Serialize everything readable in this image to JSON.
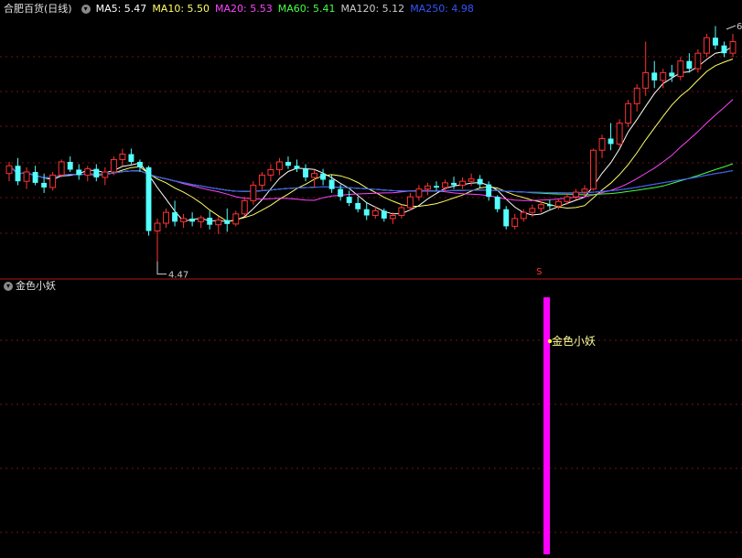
{
  "header": {
    "stock_name": "合肥百货(日线)",
    "ma": [
      {
        "label": "MA5:",
        "value": "5.47",
        "color": "#ffffff"
      },
      {
        "label": "MA10:",
        "value": "5.50",
        "color": "#ffff66"
      },
      {
        "label": "MA20:",
        "value": "5.53",
        "color": "#ff44ff"
      },
      {
        "label": "MA60:",
        "value": "5.41",
        "color": "#44ff44"
      },
      {
        "label": "MA120:",
        "value": "5.12",
        "color": "#cccccc"
      },
      {
        "label": "MA250:",
        "value": "4.98",
        "color": "#3355ff"
      }
    ]
  },
  "indicator": {
    "title": "金色小妖",
    "signal_label": "金色小妖",
    "signal_mark": "S"
  },
  "chart_data": {
    "type": "candlestick",
    "annotations": {
      "low_label": "4.47",
      "high_label": "6"
    },
    "colors": {
      "up": "#ff3333",
      "down": "#54ffff",
      "grid": "#7a1010",
      "signal": "#ff00ff"
    },
    "candles": [
      [
        5.6,
        5.75,
        5.5,
        5.7
      ],
      [
        5.7,
        5.8,
        5.45,
        5.5
      ],
      [
        5.5,
        5.68,
        5.4,
        5.62
      ],
      [
        5.62,
        5.7,
        5.45,
        5.48
      ],
      [
        5.48,
        5.6,
        5.35,
        5.42
      ],
      [
        5.42,
        5.62,
        5.38,
        5.58
      ],
      [
        5.58,
        5.78,
        5.55,
        5.75
      ],
      [
        5.75,
        5.82,
        5.62,
        5.65
      ],
      [
        5.65,
        5.72,
        5.52,
        5.58
      ],
      [
        5.58,
        5.7,
        5.5,
        5.66
      ],
      [
        5.66,
        5.72,
        5.5,
        5.55
      ],
      [
        5.55,
        5.68,
        5.45,
        5.62
      ],
      [
        5.62,
        5.82,
        5.58,
        5.78
      ],
      [
        5.78,
        5.92,
        5.7,
        5.85
      ],
      [
        5.85,
        5.92,
        5.72,
        5.75
      ],
      [
        5.75,
        5.78,
        5.62,
        5.68
      ],
      [
        5.68,
        5.7,
        4.8,
        4.86
      ],
      [
        4.86,
        5.02,
        4.47,
        4.96
      ],
      [
        4.96,
        5.15,
        4.9,
        5.1
      ],
      [
        5.1,
        5.25,
        4.92,
        4.98
      ],
      [
        4.98,
        5.08,
        4.9,
        5.02
      ],
      [
        5.02,
        5.1,
        4.92,
        4.98
      ],
      [
        4.98,
        5.06,
        4.9,
        5.03
      ],
      [
        5.03,
        5.12,
        4.88,
        4.94
      ],
      [
        4.94,
        5.05,
        4.82,
        5.0
      ],
      [
        5.0,
        5.15,
        4.85,
        4.95
      ],
      [
        4.95,
        5.12,
        4.92,
        5.08
      ],
      [
        5.08,
        5.3,
        5.05,
        5.25
      ],
      [
        5.25,
        5.5,
        5.2,
        5.45
      ],
      [
        5.45,
        5.62,
        5.38,
        5.58
      ],
      [
        5.58,
        5.72,
        5.5,
        5.65
      ],
      [
        5.65,
        5.8,
        5.58,
        5.75
      ],
      [
        5.75,
        5.82,
        5.66,
        5.7
      ],
      [
        5.7,
        5.78,
        5.62,
        5.66
      ],
      [
        5.66,
        5.72,
        5.5,
        5.55
      ],
      [
        5.55,
        5.65,
        5.42,
        5.6
      ],
      [
        5.6,
        5.66,
        5.45,
        5.52
      ],
      [
        5.52,
        5.58,
        5.35,
        5.4
      ],
      [
        5.4,
        5.46,
        5.25,
        5.3
      ],
      [
        5.3,
        5.38,
        5.18,
        5.22
      ],
      [
        5.22,
        5.3,
        5.1,
        5.14
      ],
      [
        5.14,
        5.22,
        5.0,
        5.06
      ],
      [
        5.06,
        5.18,
        5.02,
        5.12
      ],
      [
        5.12,
        5.15,
        4.98,
        5.02
      ],
      [
        5.02,
        5.1,
        4.95,
        5.06
      ],
      [
        5.06,
        5.2,
        5.02,
        5.16
      ],
      [
        5.16,
        5.35,
        5.12,
        5.3
      ],
      [
        5.3,
        5.45,
        5.25,
        5.4
      ],
      [
        5.4,
        5.48,
        5.32,
        5.44
      ],
      [
        5.44,
        5.5,
        5.38,
        5.42
      ],
      [
        5.42,
        5.52,
        5.36,
        5.48
      ],
      [
        5.48,
        5.56,
        5.4,
        5.45
      ],
      [
        5.45,
        5.55,
        5.4,
        5.5
      ],
      [
        5.5,
        5.6,
        5.44,
        5.53
      ],
      [
        5.53,
        5.58,
        5.42,
        5.46
      ],
      [
        5.46,
        5.5,
        5.25,
        5.3
      ],
      [
        5.3,
        5.32,
        5.1,
        5.14
      ],
      [
        5.14,
        5.18,
        4.88,
        4.92
      ],
      [
        4.92,
        5.08,
        4.88,
        5.02
      ],
      [
        5.02,
        5.14,
        4.98,
        5.1
      ],
      [
        5.1,
        5.2,
        5.04,
        5.15
      ],
      [
        5.15,
        5.24,
        5.1,
        5.2
      ],
      [
        5.2,
        5.26,
        5.14,
        5.18
      ],
      [
        5.18,
        5.28,
        5.14,
        5.24
      ],
      [
        5.24,
        5.34,
        5.2,
        5.3
      ],
      [
        5.3,
        5.4,
        5.26,
        5.36
      ],
      [
        5.36,
        5.45,
        5.3,
        5.4
      ],
      [
        5.4,
        5.92,
        5.38,
        5.9
      ],
      [
        5.9,
        6.1,
        5.8,
        6.05
      ],
      [
        6.05,
        6.25,
        5.9,
        5.98
      ],
      [
        5.98,
        6.3,
        5.95,
        6.25
      ],
      [
        6.25,
        6.55,
        6.2,
        6.5
      ],
      [
        6.5,
        6.75,
        6.4,
        6.7
      ],
      [
        6.7,
        7.3,
        6.6,
        6.9
      ],
      [
        6.9,
        7.05,
        6.7,
        6.8
      ],
      [
        6.8,
        6.95,
        6.7,
        6.9
      ],
      [
        6.9,
        7.0,
        6.78,
        6.85
      ],
      [
        6.85,
        7.1,
        6.8,
        7.05
      ],
      [
        7.05,
        7.15,
        6.9,
        6.95
      ],
      [
        6.95,
        7.2,
        6.9,
        7.15
      ],
      [
        7.15,
        7.4,
        7.1,
        7.35
      ],
      [
        7.35,
        7.5,
        7.2,
        7.25
      ],
      [
        7.25,
        7.3,
        7.1,
        7.15
      ],
      [
        7.15,
        7.4,
        7.1,
        7.3
      ]
    ],
    "signal_index": 61
  }
}
